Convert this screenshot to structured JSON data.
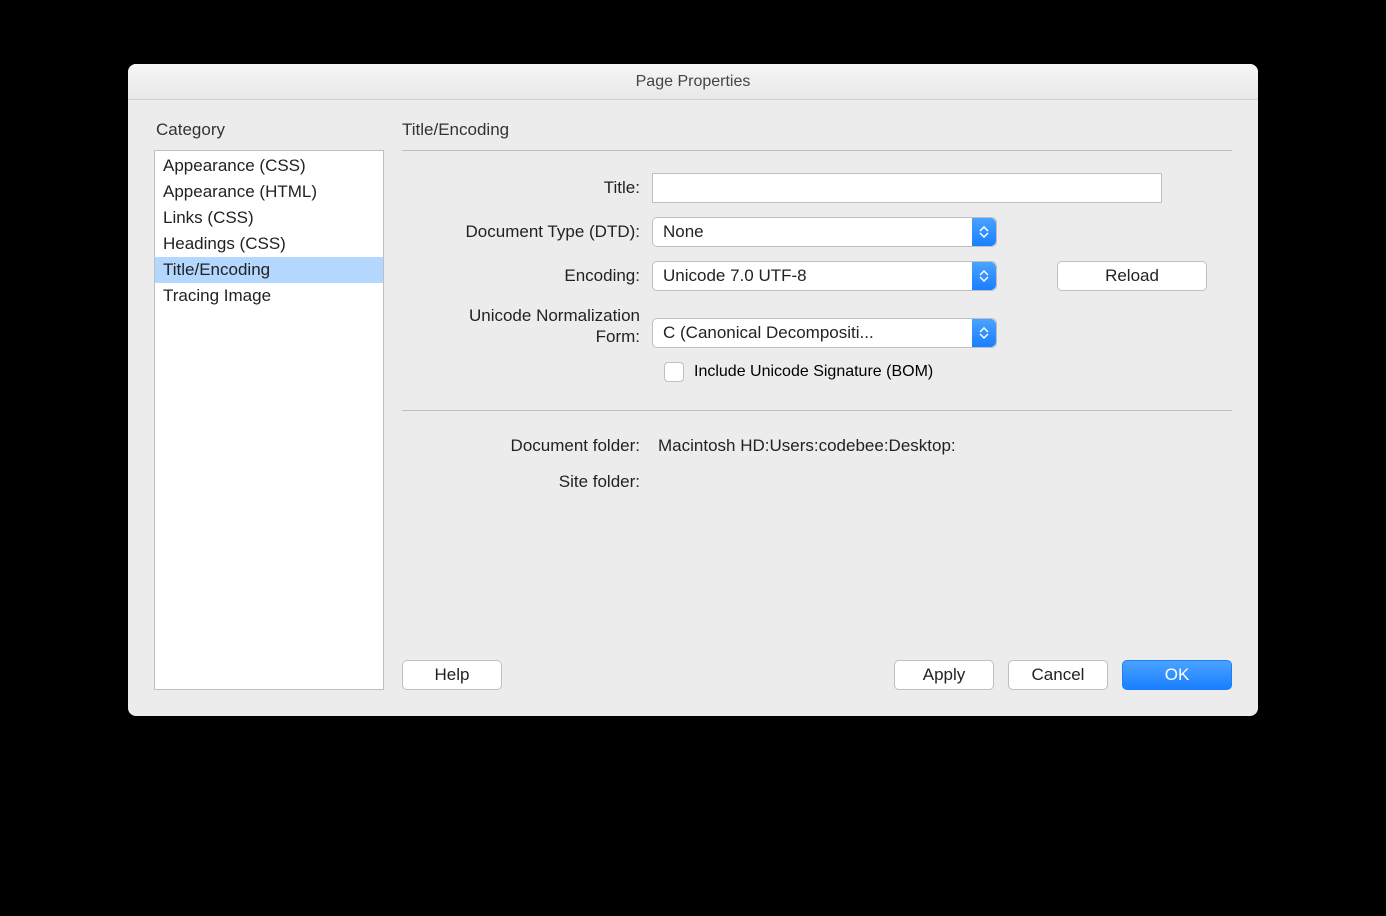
{
  "window": {
    "title": "Page Properties"
  },
  "sidebar": {
    "heading": "Category",
    "items": [
      {
        "label": "Appearance (CSS)",
        "selected": false
      },
      {
        "label": "Appearance (HTML)",
        "selected": false
      },
      {
        "label": "Links (CSS)",
        "selected": false
      },
      {
        "label": "Headings (CSS)",
        "selected": false
      },
      {
        "label": "Title/Encoding",
        "selected": true
      },
      {
        "label": "Tracing Image",
        "selected": false
      }
    ]
  },
  "panel": {
    "title": "Title/Encoding",
    "fields": {
      "title_label": "Title:",
      "title_value": "",
      "dtd_label": "Document Type (DTD):",
      "dtd_value": "None",
      "encoding_label": "Encoding:",
      "encoding_value": "Unicode 7.0 UTF-8",
      "reload_label": "Reload",
      "norm_label": "Unicode Normalization Form:",
      "norm_value": "C (Canonical Decompositi...",
      "bom_label": "Include Unicode Signature (BOM)",
      "bom_checked": false,
      "docfolder_label": "Document folder:",
      "docfolder_value": "Macintosh HD:Users:codebee:Desktop:",
      "sitefolder_label": "Site folder:",
      "sitefolder_value": ""
    }
  },
  "buttons": {
    "help": "Help",
    "apply": "Apply",
    "cancel": "Cancel",
    "ok": "OK"
  }
}
